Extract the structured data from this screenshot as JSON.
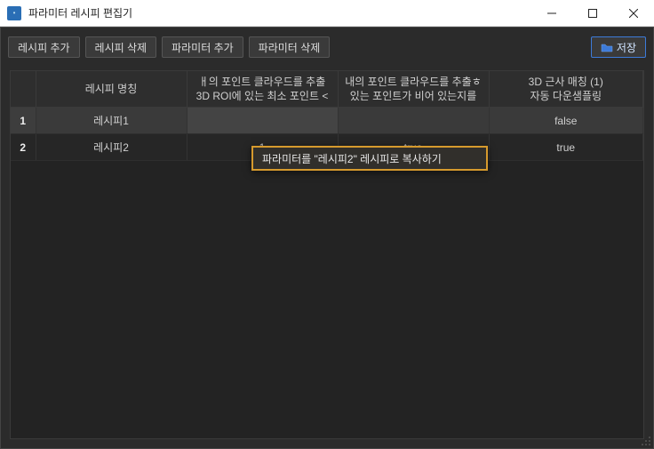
{
  "titlebar": {
    "title": "파라미터 레시피 편집기"
  },
  "toolbar": {
    "add_recipe": "레시피 추가",
    "delete_recipe": "레시피 삭제",
    "add_param": "파라미터 추가",
    "delete_param": "파라미터 삭제",
    "save": "저장"
  },
  "table": {
    "headers": {
      "name": "레시피 명칭",
      "col2_line1": "ㅐ의 포인트 클라우드를 추출",
      "col2_line2": "3D ROI에 있는 최소 포인트 <",
      "col3_line1": "내의 포인트 클라우드를 추출ㅎ",
      "col3_line2": "있는 포인트가 비어 있는지를",
      "col4_line1": "3D 근사 매칭 (1)",
      "col4_line2": "자동 다운샘플링"
    },
    "rows": [
      {
        "num": "1",
        "name": "레시피1",
        "c2": "",
        "c3": "",
        "c4": "false"
      },
      {
        "num": "2",
        "name": "레시피2",
        "c2": "1",
        "c3": "true",
        "c4": "true"
      }
    ]
  },
  "context_menu": {
    "copy_to": "파라미터를 \"레시피2\" 레시피로 복사하기"
  }
}
